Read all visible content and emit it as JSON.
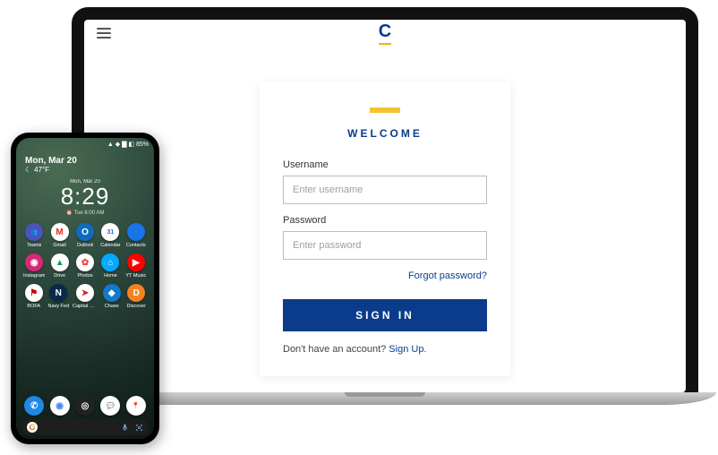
{
  "laptop": {
    "brand_letter": "C",
    "login": {
      "welcome": "WELCOME",
      "username_label": "Username",
      "username_placeholder": "Enter username",
      "password_label": "Password",
      "password_placeholder": "Enter password",
      "forgot": "Forgot password?",
      "signin": "SIGN IN",
      "signup_prompt": "Don't have an account? ",
      "signup_link": "Sign Up."
    }
  },
  "phone": {
    "status": {
      "carrier_icons": "▲ ◆ ▇ ◧ 85%"
    },
    "date": "Mon, Mar 20",
    "temp": "47°F",
    "clock": {
      "top_small": "Mon, Mar 20",
      "time": "8:29",
      "sub": "⏰ Tue 6:00 AM"
    },
    "apps_row1": [
      {
        "name": "Teams",
        "bg": "#4b53bc",
        "glyph": "👥"
      },
      {
        "name": "Gmail",
        "bg": "#ffffff",
        "glyph": "M",
        "fg": "#d93025"
      },
      {
        "name": "Outlook",
        "bg": "#0f6cbd",
        "glyph": "O"
      },
      {
        "name": "Calendar",
        "bg": "#ffffff",
        "glyph": "31",
        "fg": "#1a73e8"
      },
      {
        "name": "Contacts",
        "bg": "#1a73e8",
        "glyph": "👤"
      }
    ],
    "apps_row2": [
      {
        "name": "Instagram",
        "bg": "#d62976",
        "glyph": "◉"
      },
      {
        "name": "Drive",
        "bg": "#ffffff",
        "glyph": "▲",
        "fg": "#0f9d58"
      },
      {
        "name": "Photos",
        "bg": "#ffffff",
        "glyph": "✿",
        "fg": "#ea4335"
      },
      {
        "name": "Home",
        "bg": "#00aaff",
        "glyph": "⌂"
      },
      {
        "name": "YT Music",
        "bg": "#ff0000",
        "glyph": "▶"
      }
    ],
    "apps_row3": [
      {
        "name": "BOFA",
        "bg": "#ffffff",
        "glyph": "⚑",
        "fg": "#cc0000"
      },
      {
        "name": "Navy Fed",
        "bg": "#0a2a4d",
        "glyph": "N"
      },
      {
        "name": "Capital One",
        "bg": "#ffffff",
        "glyph": "➤",
        "fg": "#d22"
      },
      {
        "name": "Chase",
        "bg": "#117aca",
        "glyph": "◆"
      },
      {
        "name": "Discover",
        "bg": "#f58220",
        "glyph": "D"
      }
    ],
    "dock": [
      {
        "name": "Phone",
        "bg": "#1e88e5",
        "glyph": "✆"
      },
      {
        "name": "Chrome",
        "bg": "#ffffff",
        "glyph": "◉",
        "fg": "#4285F4"
      },
      {
        "name": "Camera",
        "bg": "#222",
        "glyph": "◎"
      },
      {
        "name": "Messages",
        "bg": "#ffffff",
        "glyph": "💬",
        "fg": "#1a73e8"
      },
      {
        "name": "Maps",
        "bg": "#ffffff",
        "glyph": "📍",
        "fg": "#34a853"
      }
    ],
    "search": {
      "g": "G",
      "mic": "mic-icon",
      "lens": "lens-icon"
    }
  }
}
